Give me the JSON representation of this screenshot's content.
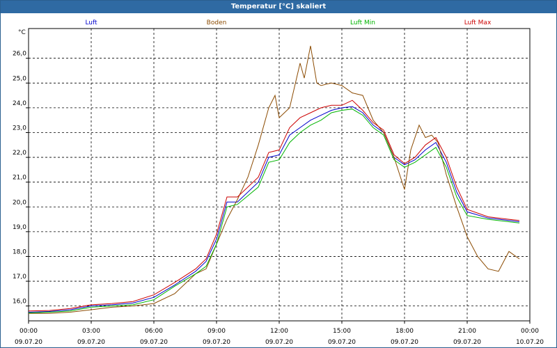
{
  "window": {
    "title": "Temperatur [°C] skaliert"
  },
  "chart_data": {
    "type": "line",
    "ylabel": "°C",
    "ylim": [
      15.4,
      27.2
    ],
    "yticks": [
      16.0,
      17.0,
      18.0,
      19.0,
      20.0,
      21.0,
      22.0,
      23.0,
      24.0,
      25.0,
      26.0
    ],
    "ytick_labels": [
      "16,0",
      "17,0",
      "18,0",
      "19,0",
      "20,0",
      "21,0",
      "22,0",
      "23,0",
      "24,0",
      "25,0",
      "26,0"
    ],
    "xlim": [
      0,
      24
    ],
    "xticks": [
      0,
      3,
      6,
      9,
      12,
      15,
      18,
      21,
      24
    ],
    "xtick_times": [
      "00:00",
      "03:00",
      "06:00",
      "09:00",
      "12:00",
      "15:00",
      "18:00",
      "21:00",
      "00:00"
    ],
    "xtick_dates": [
      "09.07.20",
      "09.07.20",
      "09.07.20",
      "09.07.20",
      "09.07.20",
      "09.07.20",
      "09.07.20",
      "09.07.20",
      "10.07.20"
    ],
    "grid": true,
    "legend": "top",
    "series": [
      {
        "name": "Luft",
        "color": "#0000cc",
        "x": [
          0,
          1,
          2,
          3,
          4,
          5,
          6,
          7,
          8,
          8.5,
          9,
          9.5,
          10,
          11,
          11.5,
          12,
          12.5,
          13,
          13.5,
          14,
          14.5,
          15,
          15.5,
          16,
          16.5,
          17,
          17.5,
          18,
          18.5,
          19,
          19.5,
          20,
          20.5,
          21,
          22,
          23,
          23.5
        ],
        "y": [
          15.75,
          15.78,
          15.85,
          16.0,
          16.05,
          16.12,
          16.35,
          16.85,
          17.4,
          17.8,
          18.7,
          20.2,
          20.2,
          21.0,
          22.0,
          22.1,
          22.9,
          23.2,
          23.5,
          23.7,
          23.9,
          24.0,
          24.05,
          23.8,
          23.3,
          23.0,
          22.0,
          21.7,
          21.9,
          22.3,
          22.6,
          21.8,
          20.6,
          19.8,
          19.55,
          19.45,
          19.4
        ]
      },
      {
        "name": "Boden",
        "color": "#8b4a00",
        "x": [
          0,
          1,
          2,
          3,
          4,
          5,
          6,
          7,
          8,
          8.5,
          9,
          9.5,
          10,
          10.5,
          11,
          11.5,
          11.8,
          12,
          12.5,
          13,
          13.2,
          13.5,
          13.8,
          14,
          14.5,
          15,
          15.5,
          16,
          16.5,
          17,
          17.5,
          18,
          18.3,
          18.7,
          19,
          19.3,
          19.6,
          20,
          20.5,
          21,
          21.5,
          22,
          22.5,
          23,
          23.5
        ],
        "y": [
          15.7,
          15.7,
          15.75,
          15.85,
          15.95,
          16.0,
          16.1,
          16.5,
          17.3,
          17.5,
          18.5,
          19.5,
          20.3,
          21.2,
          22.5,
          24.0,
          24.5,
          23.6,
          24.0,
          25.8,
          25.2,
          26.5,
          25.0,
          24.9,
          25.0,
          24.9,
          24.6,
          24.5,
          23.5,
          23.0,
          22.0,
          20.7,
          22.3,
          23.3,
          22.8,
          22.9,
          22.6,
          21.3,
          20.0,
          18.8,
          18.0,
          17.5,
          17.4,
          18.2,
          17.9
        ]
      },
      {
        "name": "Luft Min",
        "color": "#00b400",
        "x": [
          0,
          1,
          2,
          3,
          4,
          5,
          6,
          7,
          8,
          8.5,
          9,
          9.5,
          10,
          11,
          11.5,
          12,
          12.5,
          13,
          13.5,
          14,
          14.5,
          15,
          15.5,
          16,
          16.5,
          17,
          17.5,
          18,
          18.5,
          19,
          19.5,
          20,
          20.5,
          21,
          22,
          23,
          23.5
        ],
        "y": [
          15.72,
          15.75,
          15.8,
          15.95,
          16.0,
          16.05,
          16.25,
          16.8,
          17.3,
          17.6,
          18.5,
          20.0,
          20.1,
          20.8,
          21.8,
          21.9,
          22.6,
          23.0,
          23.3,
          23.5,
          23.8,
          23.9,
          23.95,
          23.7,
          23.2,
          22.9,
          21.9,
          21.6,
          21.8,
          22.1,
          22.4,
          21.6,
          20.4,
          19.65,
          19.5,
          19.4,
          19.35
        ]
      },
      {
        "name": "Luft Max",
        "color": "#cc0000",
        "x": [
          0,
          1,
          2,
          3,
          4,
          5,
          6,
          7,
          8,
          8.5,
          9,
          9.5,
          10,
          11,
          11.5,
          12,
          12.5,
          13,
          13.5,
          14,
          14.5,
          15,
          15.5,
          16,
          16.5,
          17,
          17.5,
          18,
          18.5,
          19,
          19.5,
          20,
          20.5,
          21,
          22,
          23,
          23.5
        ],
        "y": [
          15.8,
          15.82,
          15.9,
          16.05,
          16.1,
          16.18,
          16.45,
          16.95,
          17.5,
          17.9,
          18.9,
          20.4,
          20.4,
          21.2,
          22.2,
          22.3,
          23.2,
          23.6,
          23.8,
          24.0,
          24.1,
          24.1,
          24.3,
          23.9,
          23.4,
          23.1,
          22.1,
          21.75,
          22.0,
          22.5,
          22.8,
          22.0,
          20.8,
          19.9,
          19.6,
          19.5,
          19.45
        ]
      }
    ]
  }
}
